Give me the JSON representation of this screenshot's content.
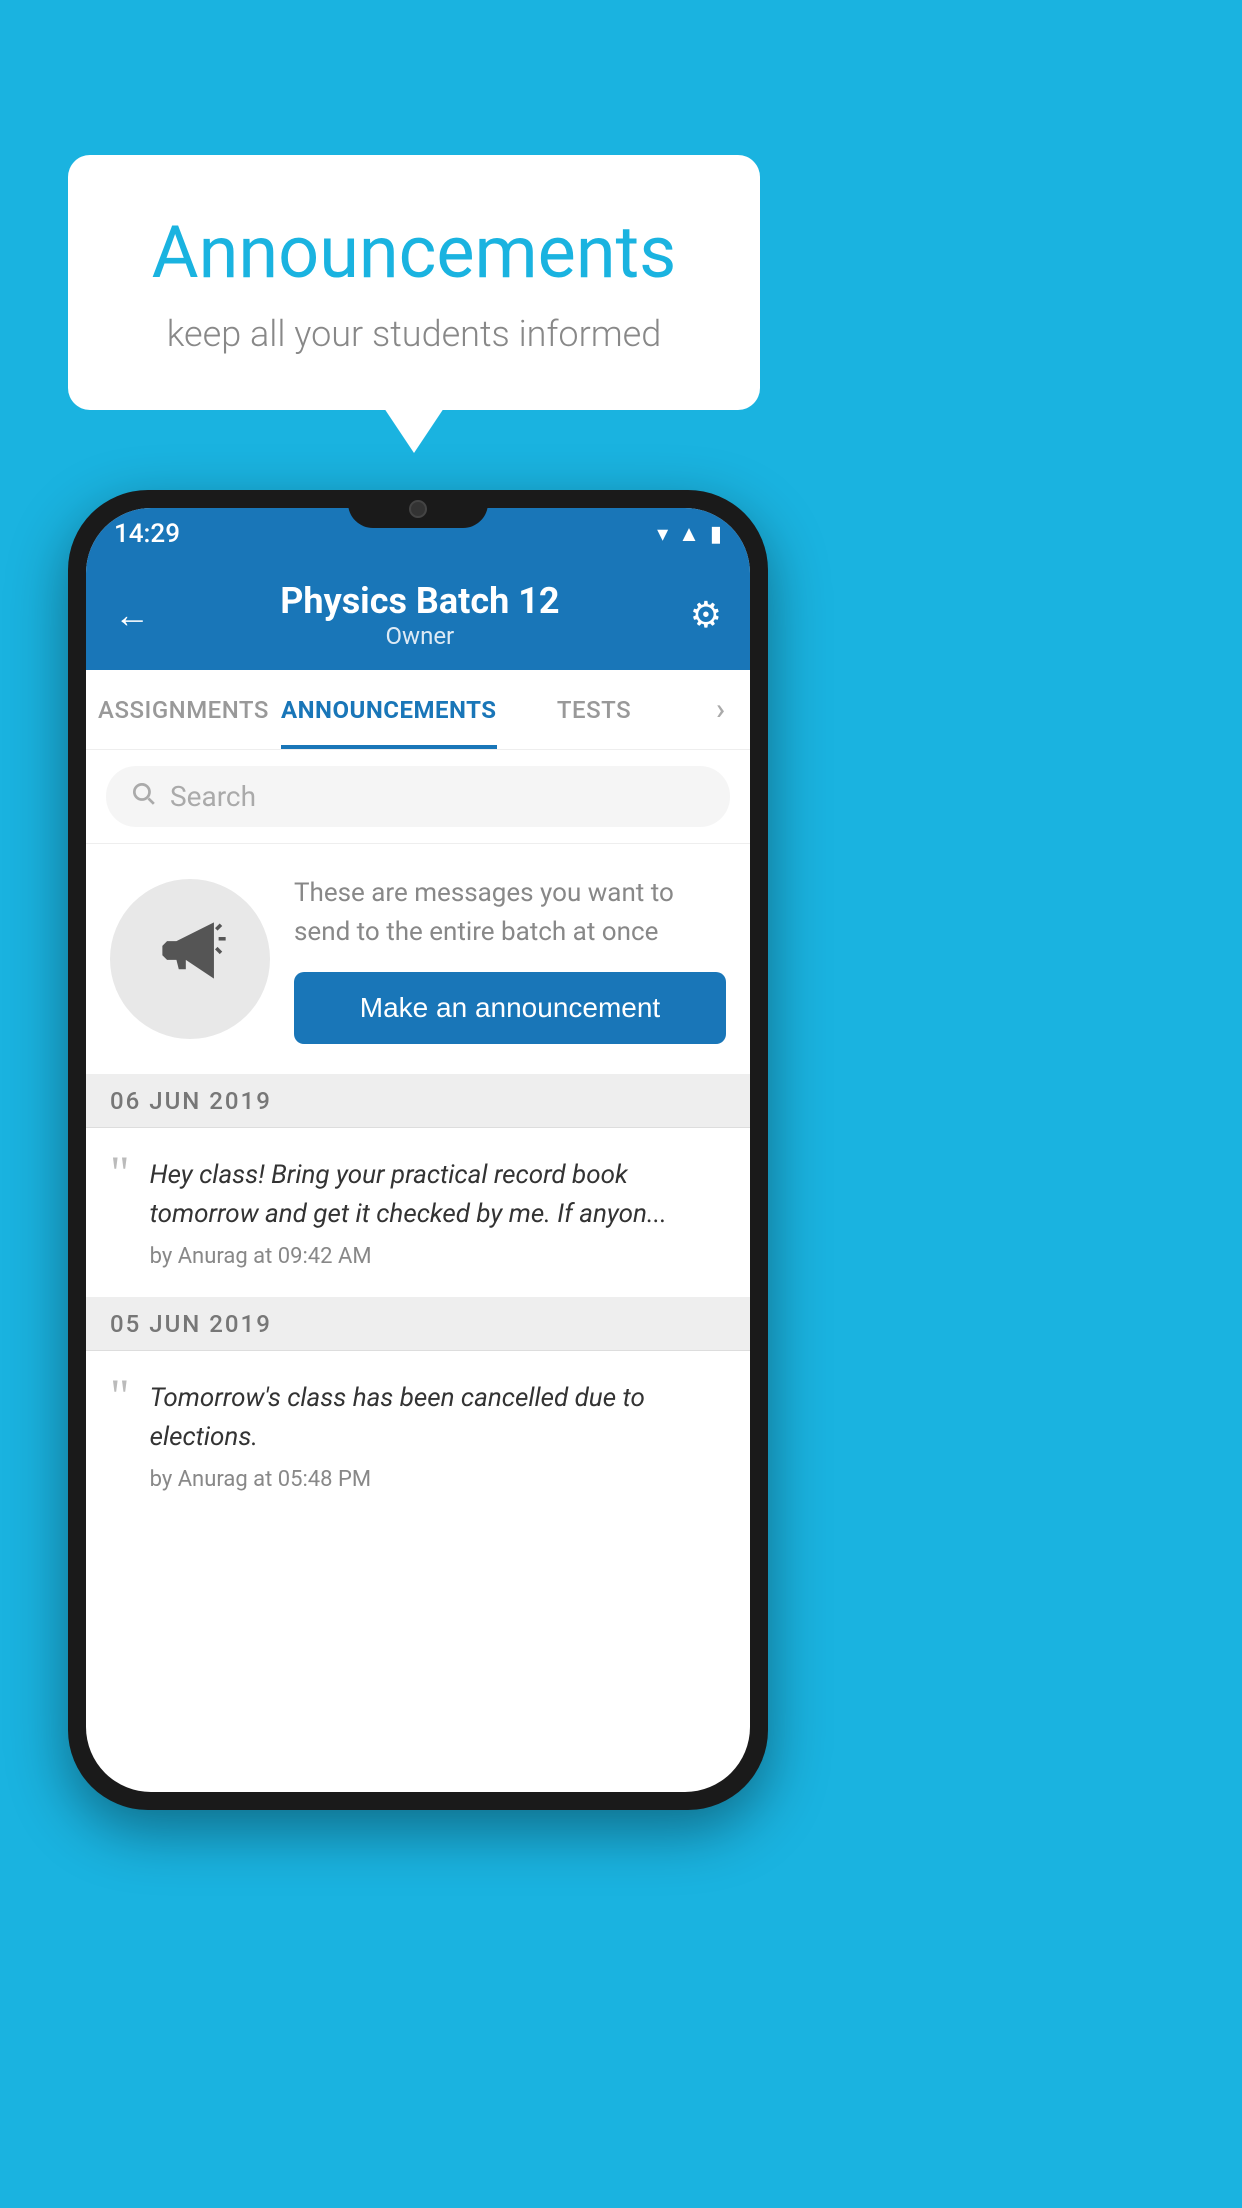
{
  "background_color": "#1ab3e0",
  "speech_bubble": {
    "title": "Announcements",
    "subtitle": "keep all your students informed"
  },
  "status_bar": {
    "time": "14:29",
    "wifi_icon": "▾",
    "signal_icon": "▲",
    "battery_icon": "▮"
  },
  "header": {
    "title": "Physics Batch 12",
    "subtitle": "Owner",
    "back_label": "←",
    "gear_label": "⚙"
  },
  "tabs": [
    {
      "label": "ASSIGNMENTS",
      "active": false
    },
    {
      "label": "ANNOUNCEMENTS",
      "active": true
    },
    {
      "label": "TESTS",
      "active": false
    },
    {
      "label": "›",
      "active": false
    }
  ],
  "search": {
    "placeholder": "Search"
  },
  "promo": {
    "description": "These are messages you want to send to the entire batch at once",
    "button_label": "Make an announcement"
  },
  "announcements": [
    {
      "date": "06  JUN  2019",
      "text": "Hey class! Bring your practical record book tomorrow and get it checked by me. If anyon...",
      "meta": "by Anurag at 09:42 AM"
    },
    {
      "date": "05  JUN  2019",
      "text": "Tomorrow's class has been cancelled due to elections.",
      "meta": "by Anurag at 05:48 PM"
    }
  ]
}
